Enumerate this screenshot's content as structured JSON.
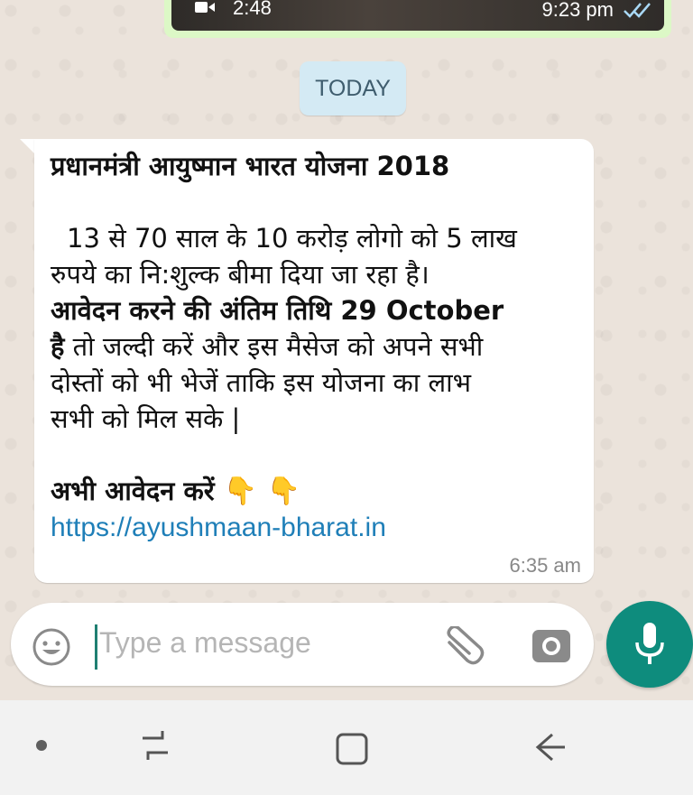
{
  "video_message": {
    "duration": "2:48",
    "time": "9:23 pm",
    "status_icon": "double-check-icon"
  },
  "date_chip": "TODAY",
  "message": {
    "title": "प्रधानमंत्री आयुष्मान भारत योजना 2018",
    "line1": "13 से 70 साल के 10 करोड़ लोगो को 5  लाख",
    "line2": "रुपये का नि:शुल्क बीमा दिया जा रहा है।",
    "bold_part1": "आवेदन करने की अंतिम तिथि 29 October",
    "bold_part2": "है",
    "line4_rest": " तो जल्दी करें और इस मैसेज को अपने सभी",
    "line5": "दोस्तों को भी भेजें ताकि इस योजना का लाभ",
    "line6": "सभी को मिल सके |",
    "cta": "अभी आवेदन करें",
    "cta_emoji": "👇 👇",
    "link": "https://ayushmaan-bharat.in",
    "time": "6:35 am"
  },
  "composer": {
    "placeholder": "Type a message",
    "icons": [
      "emoji-icon",
      "attach-icon",
      "camera-icon",
      "mic-icon"
    ]
  },
  "colors": {
    "accent": "#0e8c7d",
    "link": "#1f7fb8",
    "date_chip_bg": "#d4eaf4",
    "sent_bubble": "#dcf8c6"
  },
  "navbar": {
    "icons": [
      "nav-dot",
      "recents-icon",
      "home-icon",
      "back-icon"
    ]
  }
}
